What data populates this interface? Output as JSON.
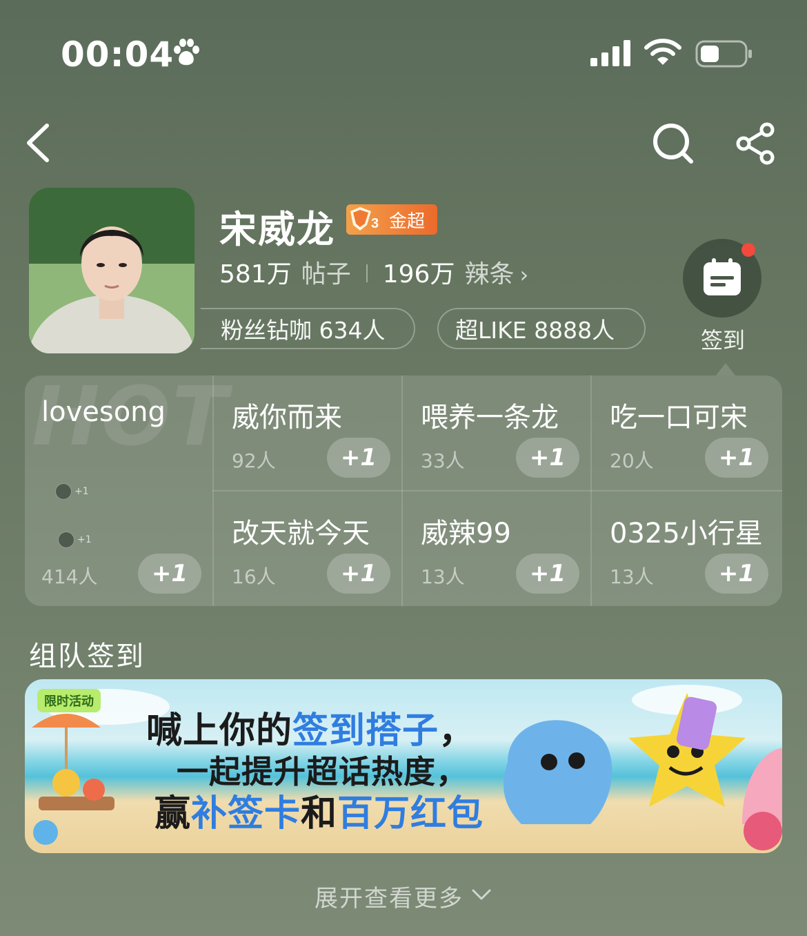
{
  "status_bar": {
    "time": "00:04"
  },
  "profile": {
    "name": "宋威龙",
    "badge_text": "金超",
    "posts_count": "581万",
    "posts_label": "帖子",
    "spicy_count": "196万",
    "spicy_label": "辣条",
    "fans_pill": "粉丝钻咖 634人",
    "like_pill": "超LIKE 8888人",
    "checkin_label": "签到"
  },
  "grid": {
    "hot": {
      "bg_text": "HOT",
      "title": "lovesong",
      "count": "414人",
      "plus": "+1",
      "mini_plus": "+1"
    },
    "cells": [
      {
        "title": "威你而来",
        "count": "92人",
        "plus": "+1"
      },
      {
        "title": "喂养一条龙",
        "count": "33人",
        "plus": "+1"
      },
      {
        "title": "吃一口可宋",
        "count": "20人",
        "plus": "+1"
      },
      {
        "title": "改天就今天",
        "count": "16人",
        "plus": "+1"
      },
      {
        "title": "威辣99",
        "count": "13人",
        "plus": "+1"
      },
      {
        "title": "0325小行星",
        "count": "13人",
        "plus": "+1"
      }
    ]
  },
  "section": {
    "title": "组队签到"
  },
  "banner": {
    "tag": "限时活动",
    "line1_a": "喊上你的",
    "line1_b": "签到搭子",
    "line1_c": "，",
    "line2": "一起提升超话热度，",
    "line3_a": "赢",
    "line3_b": "补签卡",
    "line3_c": "和",
    "line3_d": "百万红包"
  },
  "footer": {
    "expand_label": "展开查看更多"
  },
  "colors": {
    "badge_orange": "#ec6a2c",
    "notify_red": "#f24a3d",
    "banner_blue": "#2f7de0"
  }
}
